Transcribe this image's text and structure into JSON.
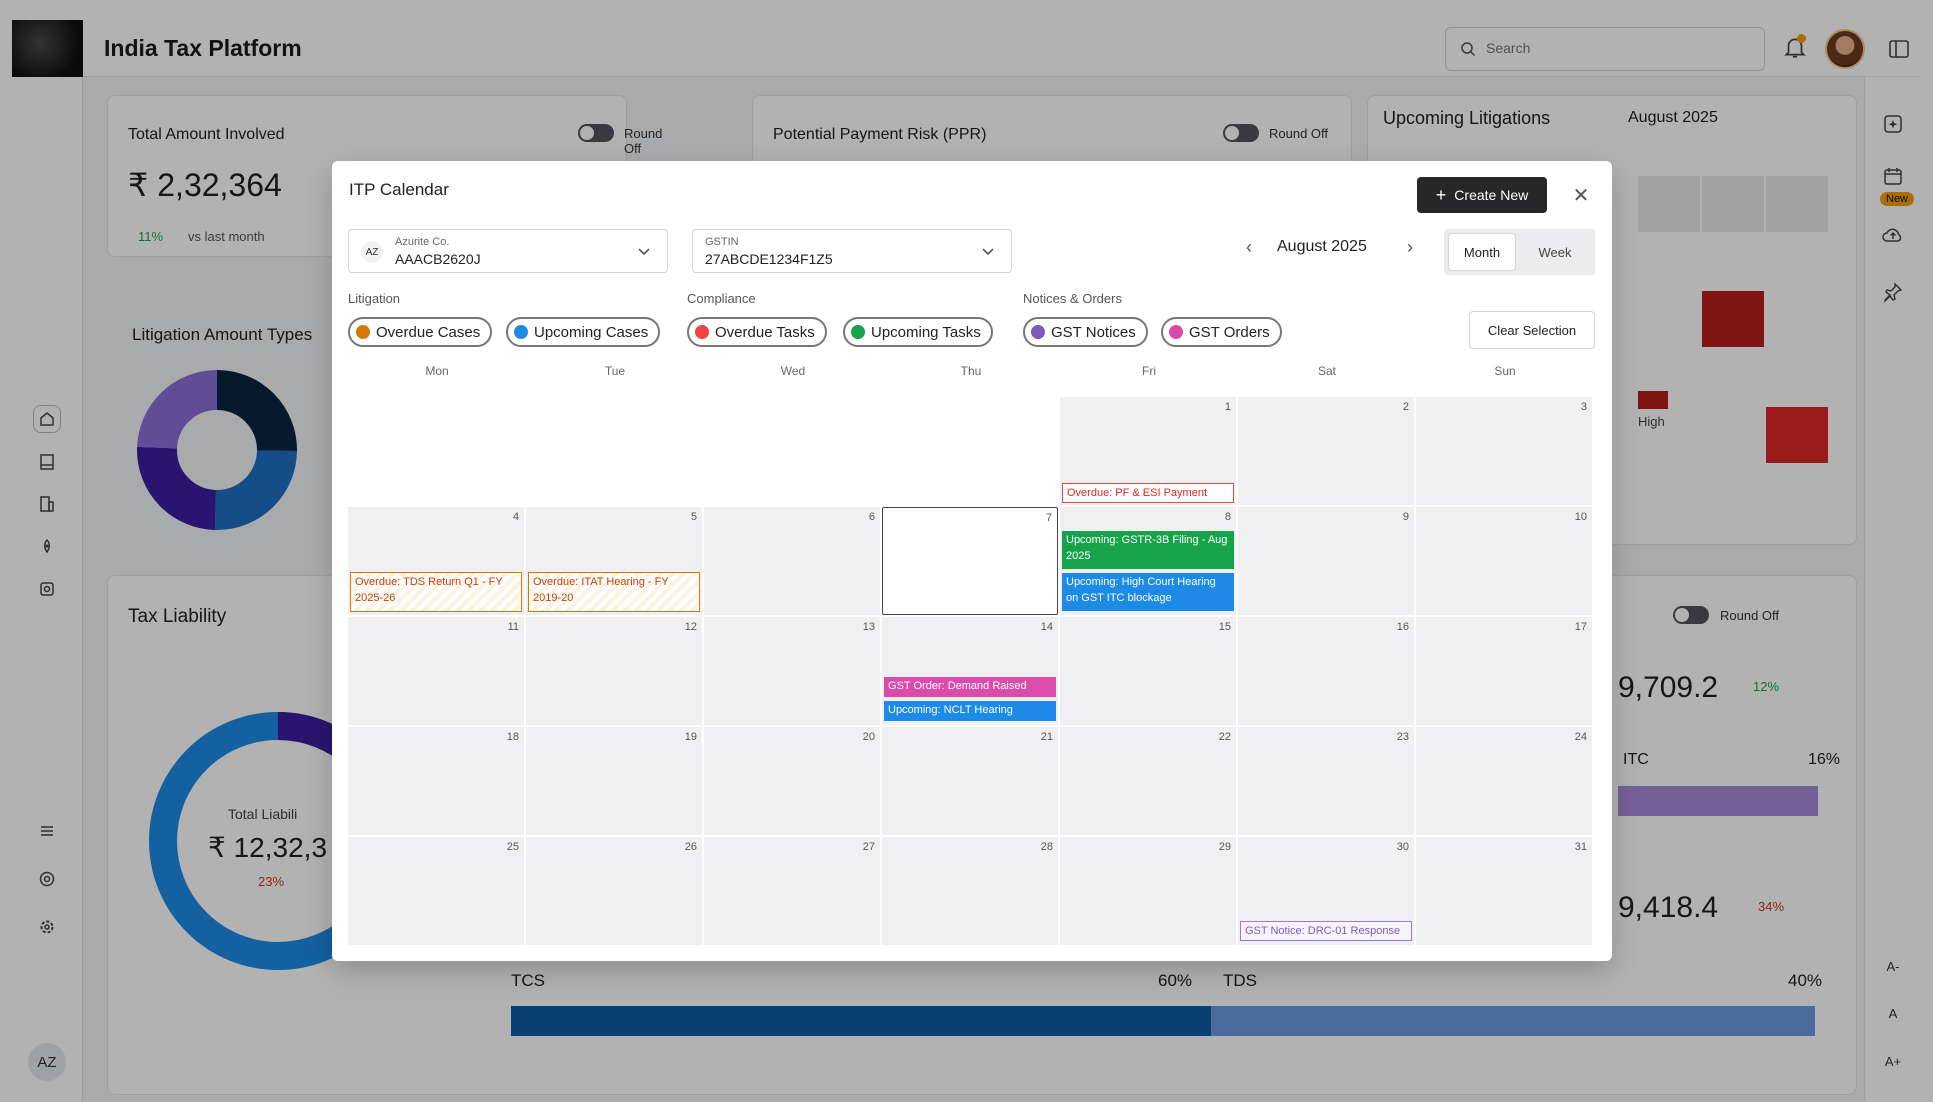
{
  "app": {
    "title": "India Tax Platform",
    "search_placeholder": "Search",
    "user_initials": "AZ",
    "new_badge": "New",
    "font_controls": [
      "A-",
      "A",
      "A+"
    ]
  },
  "background": {
    "card_total": {
      "title": "Total Amount Involved",
      "toggle_label": "Round Off",
      "amount": "₹ 2,32,364",
      "delta": "11%",
      "delta_text": "vs last month"
    },
    "card_ppr": {
      "title": "Potential Payment Risk (PPR)",
      "toggle_label": "Round Off"
    },
    "card_litigations": {
      "title": "Upcoming Litigations",
      "month": "August 2025",
      "legend_high": "High"
    },
    "litigation_types_title": "Litigation Amount Types",
    "tax_liability": {
      "title": "Tax Liability",
      "toggle_label": "Round Off",
      "center_label": "Total Liabili",
      "center_amount": "₹ 12,32,3",
      "center_delta": "23%",
      "amount_a": "9,709.2",
      "delta_a": "12%",
      "itc_label": "ITC",
      "itc_pct": "16%",
      "amount_b": "9,418.4",
      "delta_b": "34%",
      "tcs_label": "TCS",
      "tcs_pct": "60%",
      "tds_label": "TDS",
      "tds_pct": "40%"
    }
  },
  "modal": {
    "title": "ITP Calendar",
    "create_label": "Create New",
    "company": {
      "initials": "AZ",
      "label": "Azurite Co.",
      "value": "AAACB2620J"
    },
    "gstin": {
      "label": "GSTIN",
      "value": "27ABCDE1234F1Z5"
    },
    "month_label": "August 2025",
    "view_month": "Month",
    "view_week": "Week",
    "clear_label": "Clear Selection",
    "groups": {
      "litigation": "Litigation",
      "compliance": "Compliance",
      "notices": "Notices & Orders"
    },
    "filters": [
      {
        "label": "Overdue Cases",
        "color": "#d97706"
      },
      {
        "label": "Upcoming Cases",
        "color": "#1d8ae6"
      },
      {
        "label": "Overdue Tasks",
        "color": "#ef4444"
      },
      {
        "label": "Upcoming Tasks",
        "color": "#16a34a"
      },
      {
        "label": "GST Notices",
        "color": "#7c5bbd"
      },
      {
        "label": "GST Orders",
        "color": "#db4ba9"
      }
    ],
    "weekdays": [
      "Mon",
      "Tue",
      "Wed",
      "Thu",
      "Fri",
      "Sat",
      "Sun"
    ],
    "days": [
      "",
      "",
      "",
      "",
      "1",
      "2",
      "3",
      "4",
      "5",
      "6",
      "7",
      "8",
      "9",
      "10",
      "11",
      "12",
      "13",
      "14",
      "15",
      "16",
      "17",
      "18",
      "19",
      "20",
      "21",
      "22",
      "23",
      "24",
      "25",
      "26",
      "27",
      "28",
      "29",
      "30",
      "31"
    ],
    "events": [
      {
        "day": "1",
        "text": "Overdue: PF & ESI Payment"
      },
      {
        "day": "4",
        "text": "Overdue: TDS Return Q1 - FY 2025-26"
      },
      {
        "day": "5",
        "text": "Overdue: ITAT Hearing - FY 2019-20"
      },
      {
        "day": "8",
        "text": "Upcoming: GSTR-3B Filing - Aug 2025"
      },
      {
        "day": "8",
        "text": "Upcoming: High Court Hearing on GST ITC blockage"
      },
      {
        "day": "14",
        "text": "GST Order: Demand Raised"
      },
      {
        "day": "14",
        "text": "Upcoming: NCLT Hearing"
      },
      {
        "day": "30",
        "text": "GST Notice: DRC-01 Response"
      }
    ]
  }
}
